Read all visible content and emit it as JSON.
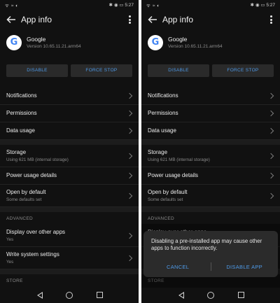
{
  "status": {
    "left_icons": "ᯤ ≈ ◐",
    "right": "✱ ◉ ▭ 5:27"
  },
  "app_bar": {
    "title": "App info"
  },
  "app": {
    "name": "Google",
    "version": "Version 10.65.11.21.arm64",
    "icon_letter": "G"
  },
  "buttons": {
    "disable": "DISABLE",
    "force_stop": "FORCE STOP"
  },
  "items": {
    "notifications": "Notifications",
    "permissions": "Permissions",
    "data_usage": "Data usage",
    "storage": {
      "title": "Storage",
      "subtitle": "Using 621 MB (internal storage)"
    },
    "power": "Power usage details",
    "open_default": {
      "title": "Open by default",
      "subtitle": "Some defaults set"
    },
    "display_over": {
      "title": "Display over other apps",
      "subtitle": "Yes"
    },
    "write_settings": {
      "title": "Write system settings",
      "subtitle": "Yes"
    }
  },
  "sections": {
    "advanced": "ADVANCED",
    "store": "STORE"
  },
  "dialog": {
    "message": "Disabling a pre-installed app may cause other apps to function incorrectly.",
    "cancel": "CANCEL",
    "disable": "DISABLE APP"
  }
}
